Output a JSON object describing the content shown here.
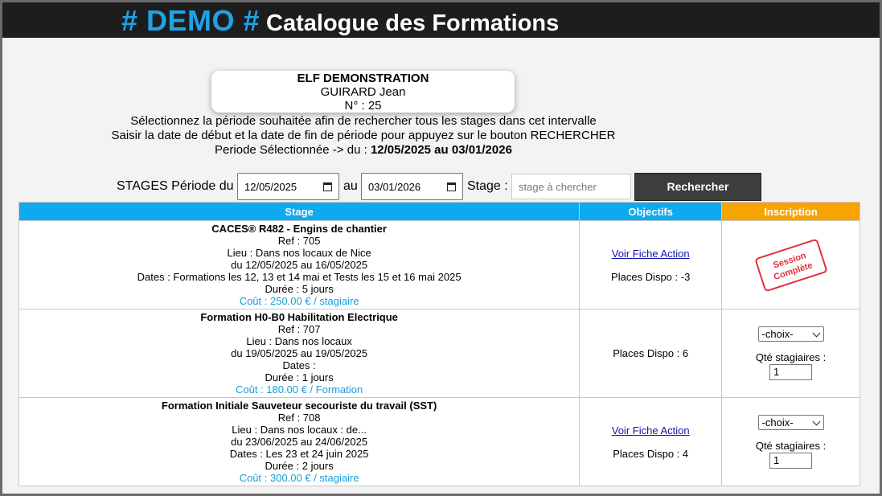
{
  "header": {
    "demo_label": "# DEMO #",
    "title": "Catalogue des Formations"
  },
  "user_card": {
    "organisation": "ELF DEMONSTRATION",
    "name": "GUIRARD Jean",
    "number": "N° : 25"
  },
  "instructions": {
    "line1": "Sélectionnez la période souhaitée afin de rechercher tous les stages dans cet intervalle",
    "line2": "Saisir la date de début et la date de fin de période pour appuyez sur le bouton RECHERCHER",
    "period_prefix": "Periode Sélectionnée -> du :",
    "period_value": "12/05/2025 au 03/01/2026"
  },
  "search": {
    "period_label": "STAGES Période du",
    "date_from": "12/05/2025",
    "to_label": "au",
    "date_to": "03/01/2026",
    "stage_label": "Stage :",
    "stage_placeholder": "stage à chercher",
    "button_label": "Rechercher"
  },
  "table": {
    "headers": {
      "stage": "Stage",
      "objectifs": "Objectifs",
      "inscription": "Inscription"
    },
    "rows": [
      {
        "title": "CACES® R482 - Engins de chantier",
        "ref": "Ref : 705",
        "lieu": "Lieu : Dans nos locaux de Nice",
        "periode": "du 12/05/2025 au 16/05/2025",
        "dates": "Dates : Formations les 12, 13 et 14 mai et Tests les 15 et 16 mai 2025",
        "duree": "Durée : 5 jours",
        "cout": "Coût : 250.00 € / stagiaire",
        "fiche_link": "Voir Fiche Action",
        "places": "Places Dispo : -3",
        "stamp_line1": "Session",
        "stamp_line2": "Complète"
      },
      {
        "title": "Formation H0-B0 Habilitation Electrique",
        "ref": "Ref : 707",
        "lieu": "Lieu : Dans nos locaux",
        "periode": "du 19/05/2025 au 19/05/2025",
        "dates": "Dates :",
        "duree": "Durée : 1 jours",
        "cout": "Coût : 180.00 € / Formation",
        "places": "Places Dispo : 6",
        "choix": "-choix-",
        "qte_label": "Qté stagiaires :",
        "qte_value": "1"
      },
      {
        "title": "Formation Initiale Sauveteur secouriste du travail (SST)",
        "ref": "Ref : 708",
        "lieu": "Lieu : Dans nos locaux : de...",
        "periode": "du 23/06/2025 au 24/06/2025",
        "dates": "Dates : Les 23 et 24 juin 2025",
        "duree": "Durée : 2 jours",
        "cout": "Coût : 300.00 € / stagiaire",
        "fiche_link": "Voir Fiche Action",
        "places": "Places Dispo : 4",
        "choix": "-choix-",
        "qte_label": "Qté stagiaires :",
        "qte_value": "1"
      }
    ]
  }
}
